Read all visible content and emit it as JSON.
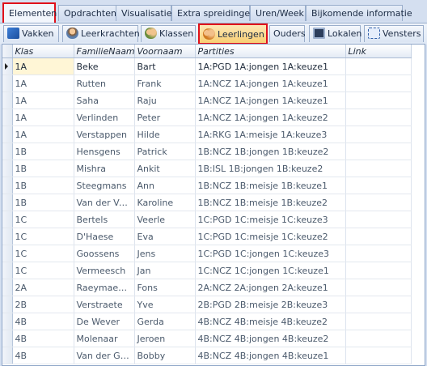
{
  "top_tabs": [
    "Elementen",
    "Opdrachten",
    "Visualisatie",
    "Extra spreidingen",
    "Uren/Week",
    "Bijkomende informatie"
  ],
  "sub_tabs": [
    "Vakken",
    "Leerkrachten",
    "Klassen",
    "Leerlingen",
    "Ouders",
    "Lokalen",
    "Vensters"
  ],
  "grid": {
    "columns": [
      "Klas",
      "FamilieNaam",
      "Voornaam",
      "Partities",
      "Link"
    ],
    "rows": [
      [
        "1A",
        "Beke",
        "Bart",
        "1A:PGD 1A:jongen 1A:keuze1",
        ""
      ],
      [
        "1A",
        "Rutten",
        "Frank",
        "1A:NCZ 1A:jongen 1A:keuze1",
        ""
      ],
      [
        "1A",
        "Saha",
        "Raju",
        "1A:NCZ 1A:jongen 1A:keuze1",
        ""
      ],
      [
        "1A",
        "Verlinden",
        "Peter",
        "1A:NCZ 1A:jongen 1A:keuze2",
        ""
      ],
      [
        "1A",
        "Verstappen",
        "Hilde",
        "1A:RKG 1A:meisje 1A:keuze3",
        ""
      ],
      [
        "1B",
        "Hensgens",
        "Patrick",
        "1B:NCZ 1B:jongen 1B:keuze2",
        ""
      ],
      [
        "1B",
        "Mishra",
        "Ankit",
        "1B:ISL 1B:jongen 1B:keuze2",
        ""
      ],
      [
        "1B",
        "Steegmans",
        "Ann",
        "1B:NCZ 1B:meisje 1B:keuze1",
        ""
      ],
      [
        "1B",
        "Van der Ve...",
        "Karoline",
        "1B:NCZ 1B:meisje 1B:keuze2",
        ""
      ],
      [
        "1C",
        "Bertels",
        "Veerle",
        "1C:PGD 1C:meisje 1C:keuze3",
        ""
      ],
      [
        "1C",
        "D'Haese",
        "Eva",
        "1C:PGD 1C:meisje 1C:keuze2",
        ""
      ],
      [
        "1C",
        "Goossens",
        "Jens",
        "1C:PGD 1C:jongen 1C:keuze3",
        ""
      ],
      [
        "1C",
        "Vermeesch",
        "Jan",
        "1C:NCZ 1C:jongen 1C:keuze1",
        ""
      ],
      [
        "2A",
        "Raeymaeck...",
        "Fons",
        "2A:NCZ 2A:jongen 2A:keuze1",
        ""
      ],
      [
        "2B",
        "Verstraete",
        "Yve",
        "2B:PGD 2B:meisje 2B:keuze3",
        ""
      ],
      [
        "4B",
        "De Wever",
        "Gerda",
        "4B:NCZ 4B:meisje 4B:keuze2",
        ""
      ],
      [
        "4B",
        "Molenaar",
        "Jeroen",
        "4B:NCZ 4B:jongen 4B:keuze2",
        ""
      ],
      [
        "4B",
        "Van der Gr...",
        "Bobby",
        "4B:NCZ 4B:jongen 4B:keuze1",
        ""
      ]
    ]
  }
}
